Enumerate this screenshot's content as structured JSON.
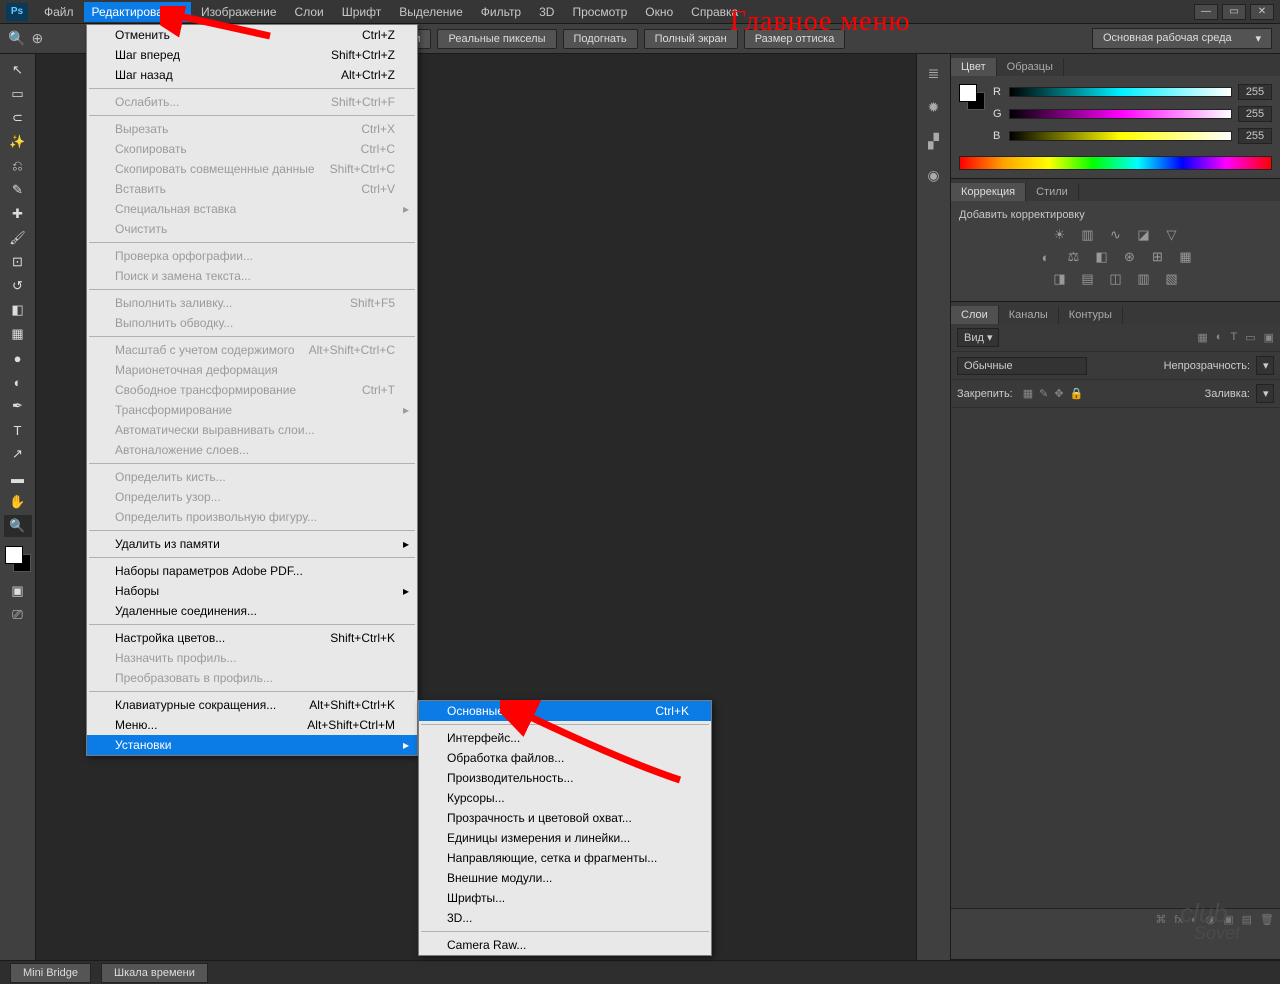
{
  "annotation": "Главное меню",
  "watermark": {
    "top": "club",
    "bottom": "Sovet"
  },
  "menubar": [
    "Файл",
    "Редактирование",
    "Изображение",
    "Слои",
    "Шрифт",
    "Выделение",
    "Фильтр",
    "3D",
    "Просмотр",
    "Окно",
    "Справка"
  ],
  "menubar_active_index": 1,
  "optionbar": {
    "buttons": [
      "аскиванием",
      "Реальные пикселы",
      "Подогнать",
      "Полный экран",
      "Размер оттиска"
    ],
    "workspace": "Основная рабочая среда"
  },
  "dropdown": [
    {
      "type": "item",
      "label": "Отменить",
      "shortcut": "Ctrl+Z"
    },
    {
      "type": "item",
      "label": "Шаг вперед",
      "shortcut": "Shift+Ctrl+Z"
    },
    {
      "type": "item",
      "label": "Шаг назад",
      "shortcut": "Alt+Ctrl+Z"
    },
    {
      "type": "sep"
    },
    {
      "type": "item",
      "label": "Ослабить...",
      "shortcut": "Shift+Ctrl+F",
      "disabled": true
    },
    {
      "type": "sep"
    },
    {
      "type": "item",
      "label": "Вырезать",
      "shortcut": "Ctrl+X",
      "disabled": true
    },
    {
      "type": "item",
      "label": "Скопировать",
      "shortcut": "Ctrl+C",
      "disabled": true
    },
    {
      "type": "item",
      "label": "Скопировать совмещенные данные",
      "shortcut": "Shift+Ctrl+C",
      "disabled": true
    },
    {
      "type": "item",
      "label": "Вставить",
      "shortcut": "Ctrl+V",
      "disabled": true
    },
    {
      "type": "item",
      "label": "Специальная вставка",
      "arrow": true,
      "disabled": true
    },
    {
      "type": "item",
      "label": "Очистить",
      "disabled": true
    },
    {
      "type": "sep"
    },
    {
      "type": "item",
      "label": "Проверка орфографии...",
      "disabled": true
    },
    {
      "type": "item",
      "label": "Поиск и замена текста...",
      "disabled": true
    },
    {
      "type": "sep"
    },
    {
      "type": "item",
      "label": "Выполнить заливку...",
      "shortcut": "Shift+F5",
      "disabled": true
    },
    {
      "type": "item",
      "label": "Выполнить обводку...",
      "disabled": true
    },
    {
      "type": "sep"
    },
    {
      "type": "item",
      "label": "Масштаб с учетом содержимого",
      "shortcut": "Alt+Shift+Ctrl+C",
      "disabled": true
    },
    {
      "type": "item",
      "label": "Марионеточная деформация",
      "disabled": true
    },
    {
      "type": "item",
      "label": "Свободное трансформирование",
      "shortcut": "Ctrl+T",
      "disabled": true
    },
    {
      "type": "item",
      "label": "Трансформирование",
      "arrow": true,
      "disabled": true
    },
    {
      "type": "item",
      "label": "Автоматически выравнивать слои...",
      "disabled": true
    },
    {
      "type": "item",
      "label": "Автоналожение слоев...",
      "disabled": true
    },
    {
      "type": "sep"
    },
    {
      "type": "item",
      "label": "Определить кисть...",
      "disabled": true
    },
    {
      "type": "item",
      "label": "Определить узор...",
      "disabled": true
    },
    {
      "type": "item",
      "label": "Определить произвольную фигуру...",
      "disabled": true
    },
    {
      "type": "sep"
    },
    {
      "type": "item",
      "label": "Удалить из памяти",
      "arrow": true
    },
    {
      "type": "sep"
    },
    {
      "type": "item",
      "label": "Наборы параметров Adobe PDF..."
    },
    {
      "type": "item",
      "label": "Наборы",
      "arrow": true
    },
    {
      "type": "item",
      "label": "Удаленные соединения..."
    },
    {
      "type": "sep"
    },
    {
      "type": "item",
      "label": "Настройка цветов...",
      "shortcut": "Shift+Ctrl+K"
    },
    {
      "type": "item",
      "label": "Назначить профиль...",
      "disabled": true
    },
    {
      "type": "item",
      "label": "Преобразовать в профиль...",
      "disabled": true
    },
    {
      "type": "sep"
    },
    {
      "type": "item",
      "label": "Клавиатурные сокращения...",
      "shortcut": "Alt+Shift+Ctrl+K"
    },
    {
      "type": "item",
      "label": "Меню...",
      "shortcut": "Alt+Shift+Ctrl+M"
    },
    {
      "type": "item",
      "label": "Установки",
      "arrow": true,
      "hl": true
    }
  ],
  "submenu": [
    {
      "type": "item",
      "label": "Основные...",
      "shortcut": "Ctrl+K",
      "hl": true
    },
    {
      "type": "sep"
    },
    {
      "type": "item",
      "label": "Интерфейс..."
    },
    {
      "type": "item",
      "label": "Обработка файлов..."
    },
    {
      "type": "item",
      "label": "Производительность..."
    },
    {
      "type": "item",
      "label": "Курсоры..."
    },
    {
      "type": "item",
      "label": "Прозрачность и цветовой охват..."
    },
    {
      "type": "item",
      "label": "Единицы измерения и линейки..."
    },
    {
      "type": "item",
      "label": "Направляющие, сетка и фрагменты..."
    },
    {
      "type": "item",
      "label": "Внешние модули..."
    },
    {
      "type": "item",
      "label": "Шрифты..."
    },
    {
      "type": "item",
      "label": "3D..."
    },
    {
      "type": "sep"
    },
    {
      "type": "item",
      "label": "Camera Raw..."
    }
  ],
  "panels": {
    "color": {
      "tabs": [
        "Цвет",
        "Образцы"
      ],
      "r": "255",
      "g": "255",
      "b": "255",
      "ch": [
        "R",
        "G",
        "B"
      ]
    },
    "correction": {
      "tabs": [
        "Коррекция",
        "Стили"
      ],
      "title": "Добавить корректировку"
    },
    "layers": {
      "tabs": [
        "Слои",
        "Каналы",
        "Контуры"
      ],
      "kind": "Вид",
      "mode": "Обычные",
      "opacity_label": "Непрозрачность:",
      "lock_label": "Закрепить:",
      "fill_label": "Заливка:"
    }
  },
  "statusbar": {
    "tabs": [
      "Mini Bridge",
      "Шкала времени"
    ]
  }
}
